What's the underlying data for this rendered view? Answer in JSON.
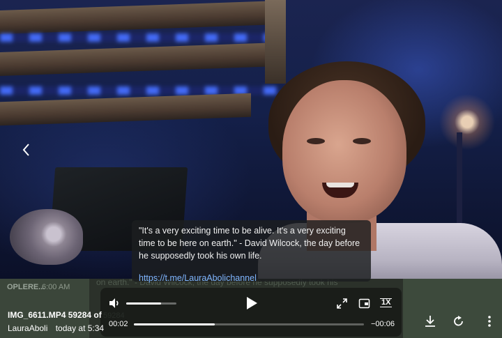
{
  "viewer": {
    "caption": {
      "text": "\"It's a very exciting time to be alive. It's a very exciting time to be here on earth.\" - David Wilcock, the day before he supposedly took his own life.",
      "link": "https://t.me/LauraAbolichannel"
    },
    "controls": {
      "current_time": "00:02",
      "remaining_time": "−00:06",
      "speed_label": "1X",
      "progress_fraction": 0.35,
      "volume_fraction": 0.7
    },
    "file": {
      "name": "IMG_6611.MP4 59284 of",
      "sender": "LauraAboli",
      "timestamp": "today at 5:34"
    },
    "chat_behind": {
      "sender_fragment": "OPLERE...",
      "time_fragment": "6:00 AM",
      "message_fragment": "on earth.\" - David Wilcock, the day before he supposedly took his",
      "count_fragment": "59284"
    },
    "icons": {
      "prev": "chevron-left-icon",
      "volume": "volume-icon",
      "play": "play-icon",
      "fullscreen": "fullscreen-icon",
      "pip": "picture-in-picture-icon",
      "download": "download-icon",
      "forward": "forward-icon",
      "more": "more-vertical-icon"
    },
    "colors": {
      "link": "#7fb6ff",
      "controls_bg": "#141614"
    }
  }
}
